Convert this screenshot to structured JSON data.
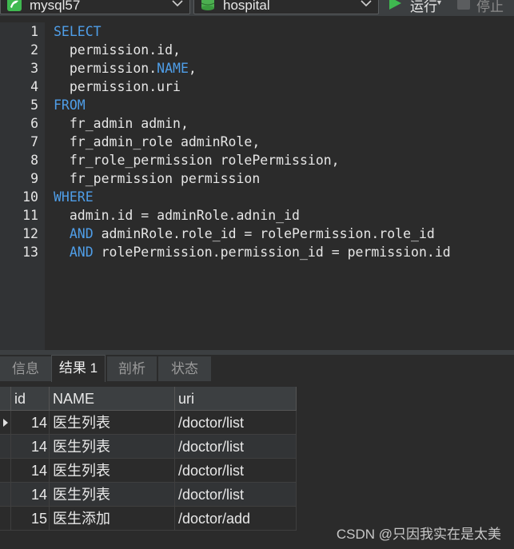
{
  "toolbar": {
    "connection": "mysql57",
    "database": "hospital",
    "run_label": "运行",
    "stop_label": "停止",
    "icons": {
      "connection": "dolphin-connection-icon",
      "database": "database-cylinder-icon",
      "run": "play-icon",
      "stop": "stop-square-icon"
    },
    "colors": {
      "run": "#3fb950",
      "database": "#4caf50",
      "connection": "#3fb950"
    }
  },
  "editor": {
    "line_numbers": [
      "1",
      "2",
      "3",
      "4",
      "5",
      "6",
      "7",
      "8",
      "9",
      "10",
      "11",
      "12",
      "13"
    ],
    "lines": [
      [
        {
          "t": "SELECT",
          "k": true
        }
      ],
      [
        {
          "t": "  permission.id,",
          "k": false
        }
      ],
      [
        {
          "t": "  permission.",
          "k": false
        },
        {
          "t": "NAME",
          "k": true
        },
        {
          "t": ",",
          "k": false
        }
      ],
      [
        {
          "t": "  permission.uri",
          "k": false
        }
      ],
      [
        {
          "t": "FROM",
          "k": true
        }
      ],
      [
        {
          "t": "  fr_admin admin,",
          "k": false
        }
      ],
      [
        {
          "t": "  fr_admin_role adminRole,",
          "k": false
        }
      ],
      [
        {
          "t": "  fr_role_permission rolePermission,",
          "k": false
        }
      ],
      [
        {
          "t": "  fr_permission permission",
          "k": false
        }
      ],
      [
        {
          "t": "WHERE",
          "k": true
        }
      ],
      [
        {
          "t": "  admin.id = adminRole.adnin_id",
          "k": false
        }
      ],
      [
        {
          "t": "  ",
          "k": false
        },
        {
          "t": "AND",
          "k": true
        },
        {
          "t": " adminRole.role_id = rolePermission.role_id",
          "k": false
        }
      ],
      [
        {
          "t": "  ",
          "k": false
        },
        {
          "t": "AND",
          "k": true
        },
        {
          "t": " rolePermission.permission_id = permission.id",
          "k": false
        }
      ]
    ],
    "keyword_color": "#4f9ee8"
  },
  "tabs": [
    "信息",
    "结果 1",
    "剖析",
    "状态"
  ],
  "active_tab": "结果 1",
  "results": {
    "columns": [
      "id",
      "NAME",
      "uri"
    ],
    "rows": [
      [
        "14",
        "医生列表",
        "/doctor/list"
      ],
      [
        "14",
        "医生列表",
        "/doctor/list"
      ],
      [
        "14",
        "医生列表",
        "/doctor/list"
      ],
      [
        "14",
        "医生列表",
        "/doctor/list"
      ],
      [
        "15",
        "医生添加",
        "/doctor/add"
      ]
    ],
    "current_row": 0
  },
  "watermark": "CSDN @只因我实在是太美"
}
